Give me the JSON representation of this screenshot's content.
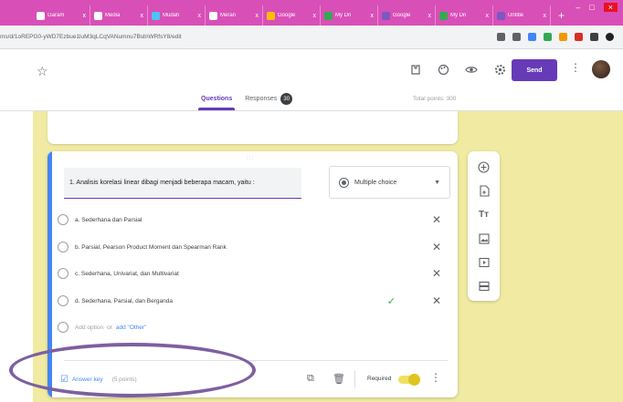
{
  "browser": {
    "tabs": [
      {
        "title": "Garam",
        "color": "#ffffff"
      },
      {
        "title": "Media",
        "color": "#ffffff"
      },
      {
        "title": "Mudah",
        "color": "#4fc3f7"
      },
      {
        "title": "Meran",
        "color": "#ffffff"
      },
      {
        "title": "Google",
        "color": "#fbbc04"
      },
      {
        "title": "My Dri",
        "color": "#34a853"
      },
      {
        "title": "Google",
        "color": "#7e57c2"
      },
      {
        "title": "My Dri",
        "color": "#34a853"
      },
      {
        "title": "Untitle",
        "color": "#7e57c2"
      }
    ],
    "tab_close": "x",
    "new_tab": "+",
    "window_controls": {
      "minimize": "–",
      "maximize": "□",
      "close": "×"
    },
    "url": "ms/d/1oREPG0-yWD7Ezbue1luM3qLCqVANumnu7Bsb\\WRfsY8/edit",
    "extensions": [
      "#5f6368",
      "#5f6368",
      "#4285f4",
      "#34a853",
      "#f29900",
      "#d93025",
      "#3c4043",
      "#202124"
    ]
  },
  "header": {
    "star": "☆",
    "icons": [
      "addon-icon",
      "palette-icon",
      "preview-icon",
      "settings-icon"
    ],
    "send_label": "Send",
    "tabs": {
      "questions": "Questions",
      "responses": "Responses",
      "responses_count": "30"
    },
    "total_points": "Total points: 300"
  },
  "question": {
    "drag_handle": ":::",
    "text": "1. Analisis korelasi linear dibagi menjadi beberapa macam, yaitu :",
    "type": "Multiple choice",
    "options": [
      {
        "label": "a. Sederhana dan Parsial",
        "correct": false
      },
      {
        "label": "b. Parsial, Pearson Product Moment dan Spearman Rank",
        "correct": false
      },
      {
        "label": "c. Sederhana, Univariat, dan Multivariat",
        "correct": false
      },
      {
        "label": "d. Sederhana, Parsial, dan Berganda",
        "correct": true
      }
    ],
    "add_option": "Add option",
    "or": "or",
    "add_other": "add \"Other\"",
    "answer_key": "Answer key",
    "points": "(5 points)",
    "required_label": "Required"
  },
  "colors": {
    "accent": "#673ab7",
    "background": "#f0eaa2",
    "highlight": "#7e5fa0"
  }
}
